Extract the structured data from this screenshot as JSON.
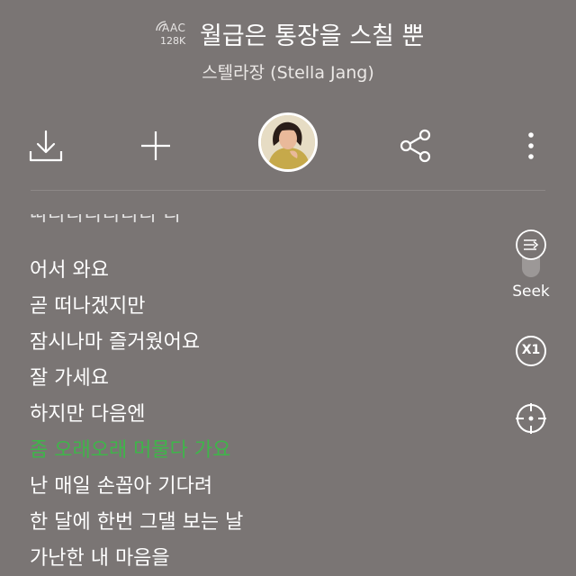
{
  "header": {
    "quality_codec": "AAC",
    "quality_bitrate": "128K",
    "song_title": "월급은 통장을 스칠 뿐",
    "artist": "스텔라장 (Stella Jang)"
  },
  "toolbar": {
    "download_icon": "download-icon",
    "add_icon": "plus-icon",
    "share_icon": "share-icon",
    "more_icon": "more-vertical-icon"
  },
  "lyrics": {
    "lines": [
      "어서 와요",
      "곧 떠나겠지만",
      "잠시나마 즐거웠어요",
      "잘 가세요",
      "하지만 다음엔",
      "좀 오래오래 머물다 가요",
      "난 매일 손꼽아 기다려",
      "한 달에 한번 그댈 보는 날",
      "가난한 내 마음을"
    ],
    "active_index": 5
  },
  "side_controls": {
    "seek_label": "Seek",
    "speed_label": "X1"
  },
  "colors": {
    "background": "#7a7574",
    "active_lyric": "#3fb54a",
    "text": "#ffffff"
  }
}
